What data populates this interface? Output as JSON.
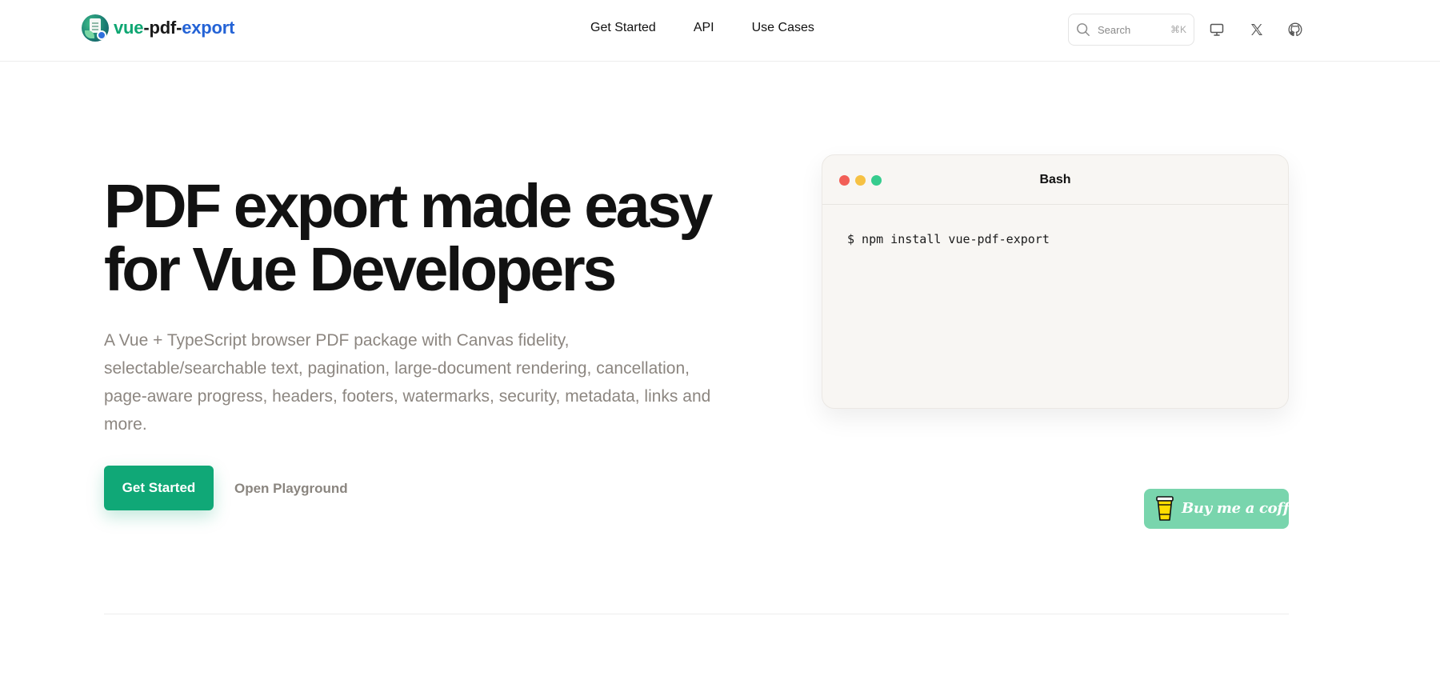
{
  "brand": {
    "name_part1": "vue",
    "name_sep1": "-",
    "name_part2": "pdf",
    "name_sep2": "-",
    "name_part3": "export"
  },
  "nav": {
    "items": [
      {
        "label": "Get Started"
      },
      {
        "label": "API"
      },
      {
        "label": "Use Cases"
      }
    ]
  },
  "search": {
    "placeholder": "Search",
    "shortcut": "⌘K"
  },
  "header_icons": [
    "monitor-icon",
    "x-logo-icon",
    "github-icon"
  ],
  "hero": {
    "title_line1": "PDF export made easy",
    "title_line2": "for Vue Developers",
    "description": "A Vue + TypeScript browser PDF package with Canvas fidelity, selectable/searchable text, pagination, large-document rendering, cancellation, page-aware progress, headers, footers, watermarks, security, metadata, links and more.",
    "primary_button": "Get Started",
    "secondary_button": "Open Playground"
  },
  "terminal": {
    "title": "Bash",
    "command": "$ npm install vue-pdf-export",
    "dot_colors": [
      "#f25f57",
      "#f6c143",
      "#36cc8e"
    ]
  },
  "coffee": {
    "label": "Buy me a coffee"
  },
  "colors": {
    "accent_green": "#10a877",
    "brand_blue": "#2463d6",
    "coffee_bg": "#79d5ad"
  }
}
